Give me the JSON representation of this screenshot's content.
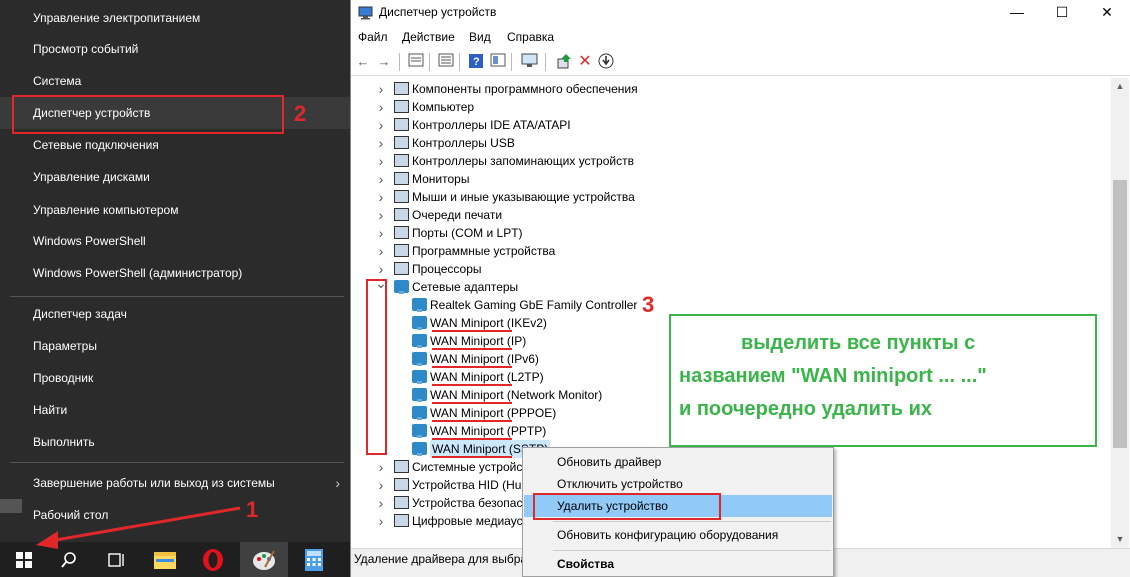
{
  "winx_menu": {
    "items": [
      "Управление электропитанием",
      "Просмотр событий",
      "Система",
      "Диспетчер устройств",
      "Сетевые подключения",
      "Управление дисками",
      "Управление компьютером",
      "Windows PowerShell",
      "Windows PowerShell (администратор)",
      "Диспетчер задач",
      "Параметры",
      "Проводник",
      "Найти",
      "Выполнить",
      "Завершение работы или выход из системы",
      "Рабочий стол"
    ],
    "submenu_arrow": "›"
  },
  "taskbar": {
    "icons": [
      "start-icon",
      "search-icon",
      "task-view-icon",
      "file-explorer-icon",
      "opera-icon",
      "paint-icon",
      "calculator-icon"
    ]
  },
  "device_manager": {
    "title": "Диспетчер устройств",
    "controls": {
      "minimize": "—",
      "maximize": "☐",
      "close": "✕"
    },
    "menu": [
      "Файл",
      "Действие",
      "Вид",
      "Справка"
    ],
    "tree": [
      "Компоненты программного обеспечения",
      "Компьютер",
      "Контроллеры IDE ATA/ATAPI",
      "Контроллеры USB",
      "Контроллеры запоминающих устройств",
      "Мониторы",
      "Мыши и иные указывающие устройства",
      "Очереди печати",
      "Порты (COM и LPT)",
      "Программные устройства",
      "Процессоры",
      "Сетевые адаптеры",
      "Realtek Gaming GbE Family Controller",
      "WAN Miniport (IKEv2)",
      "WAN Miniport (IP)",
      "WAN Miniport (IPv6)",
      "WAN Miniport (L2TP)",
      "WAN Miniport (Network Monitor)",
      "WAN Miniport (PPPOE)",
      "WAN Miniport (PPTP)",
      "WAN Miniport (SSTP)",
      "Системные устройства",
      "Устройства HID (Human Interface Devices)",
      "Устройства безопасности",
      "Цифровые медиаустройства"
    ],
    "status_text": "Удаление драйвера для выбранного устройства."
  },
  "context_menu": {
    "items": [
      "Обновить драйвер",
      "Отключить устройство",
      "Удалить устройство",
      "Обновить конфигурацию оборудования",
      "Свойства"
    ],
    "highlighted": "Удалить устройство"
  },
  "annotations": {
    "step1": "1",
    "step2": "2",
    "step3": "3",
    "note_lines": [
      "выделить все пункты с",
      "названием \"WAN miniport ... ...\"",
      "и поочередно удалить их"
    ],
    "red": "#e0282b",
    "green": "#39b54a"
  },
  "colors": {
    "menu_bg": "#2b2b2b",
    "taskbar_bg": "#1f1f1f",
    "selection": "#cce8ff",
    "context_highlight": "#91c9f7"
  }
}
